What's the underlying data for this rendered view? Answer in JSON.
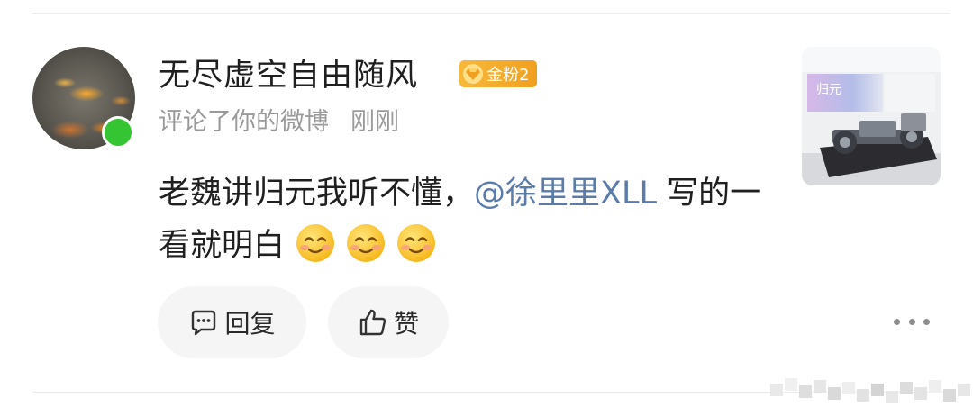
{
  "comment": {
    "username": "无尽虚空自由随风",
    "badge_label": "金粉2",
    "action": "评论了你的微博",
    "time": "刚刚",
    "text_before_mention": "老魏讲归元我听不懂，",
    "mention": "@徐里里XLL",
    "text_after_mention": " 写的一看就明白",
    "emoji_count": 3,
    "emoji_icon": "smiling-face-icon"
  },
  "thumbnail": {
    "caption": "归元"
  },
  "actions": {
    "reply_label": "回复",
    "like_label": "赞",
    "reply_icon": "comment-bubble-icon",
    "like_icon": "thumbs-up-icon",
    "more_icon": "more-dots-icon"
  },
  "colors": {
    "online": "#35c432",
    "badge": "#f0a020",
    "mention": "#5b7cab",
    "pill_bg": "#f5f5f5"
  }
}
